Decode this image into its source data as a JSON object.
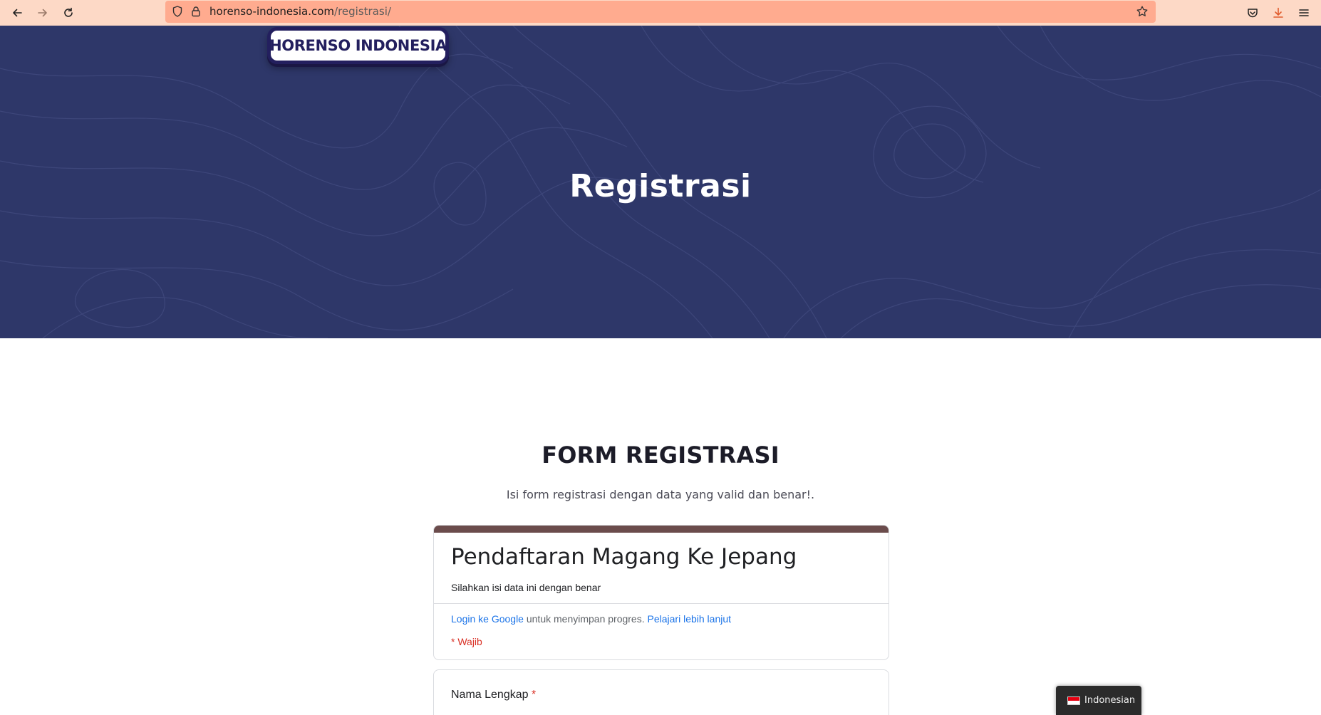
{
  "browser": {
    "url_host": "horenso-indonesia.com",
    "url_path": "/registrasi/"
  },
  "hero": {
    "logo_text": "HORENSO INDONESIA",
    "title": "Registrasi"
  },
  "main": {
    "heading": "FORM REGISTRASI",
    "subheading": "Isi  form registrasi dengan data yang valid dan benar!."
  },
  "google_form": {
    "title": "Pendaftaran Magang Ke Jepang",
    "description": "Silahkan isi data ini dengan benar",
    "login_link": "Login ke Google",
    "login_text": " untuk menyimpan progres. ",
    "learn_more_link": "Pelajari lebih lanjut",
    "required_note": "* Wajib",
    "questions": [
      {
        "label": "Nama Lengkap",
        "required_mark": "*"
      }
    ]
  },
  "language_switcher": {
    "label": "Indonesian"
  },
  "colors": {
    "toolbar": "#fdd9c6",
    "urlbar": "#ffab8f",
    "hero_bg": "#2e3769",
    "form_accent": "#6b4c4c",
    "link": "#1a73e8",
    "required": "#d93025"
  }
}
